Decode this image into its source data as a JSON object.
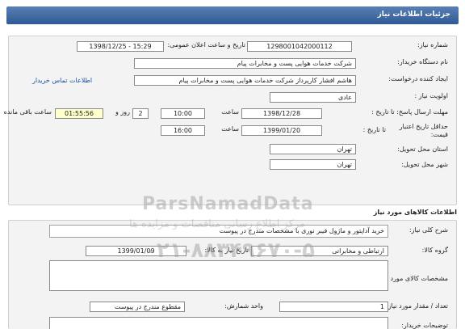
{
  "header": {
    "title": "جزئیات اطلاعات نیاز"
  },
  "need_info": {
    "need_number_label": "شماره نیاز:",
    "need_number": "1298001042000112",
    "announce_label": "تاریخ و ساعت اعلان عمومی:",
    "announce_value": "1398/12/25 - 15:29",
    "buyer_org_label": "نام دستگاه خریدار:",
    "buyer_org": "شرکت خدمات هوایی پست و مخابرات پیام",
    "creator_label": "ایجاد کننده درخواست:",
    "creator": "هاشم افشار کارپرداز شرکت خدمات هوایی پست و مخابرات پیام",
    "contact_link": "اطلاعات تماس خریدار",
    "priority_label": "اولویت نیاز :",
    "priority": "عادی",
    "deadline_label": "مهلت ارسال پاسخ: تا تاریخ :",
    "deadline_date": "1398/12/28",
    "time_label": "ساعت",
    "deadline_time": "10:00",
    "days_value": "2",
    "days_label": "روز و",
    "remaining_time": "01:55:56",
    "remaining_label": "ساعت باقی مانده",
    "validity_label": "حداقل تاریخ اعتبار قیمت:",
    "validity_to_label": "تا تاریخ :",
    "validity_date": "1399/01/20",
    "validity_time_label": "ساعت",
    "validity_time": "16:00",
    "province_label": "استان محل تحویل:",
    "province": "تهران",
    "city_label": "شهر محل تحویل:",
    "city": "تهران"
  },
  "goods": {
    "section_title": "اطلاعات کالاهای مورد نیاز",
    "summary_label": "شرح کلی نیاز:",
    "summary": "خرید آداپتور و ماژول فیبر نوری با مشخصات مندرج در پیوست",
    "group_label": "گروه کالا:",
    "group": "ارتباطی و مخابراتی",
    "need_date_label": "تاریخ نیاز به کالا:",
    "need_date": "1399/01/09",
    "spec_label": "مشخصات کالای مورد نیاز:",
    "qty_label": "تعداد / مقدار مورد نیاز:",
    "qty": "1",
    "unit_label": "واحد شمارش:",
    "unit": "مقطوع مندرج در پیوست",
    "buyer_notes_label": "توضیحات خریدار:"
  },
  "watermark": {
    "site": "ParsNamadData",
    "phone": "۰۲۱-۸۸۳۴۹۶۷۰-۵",
    "tagline": "مرکز اطلاع رسانی مناقصات و مزایده ها"
  }
}
